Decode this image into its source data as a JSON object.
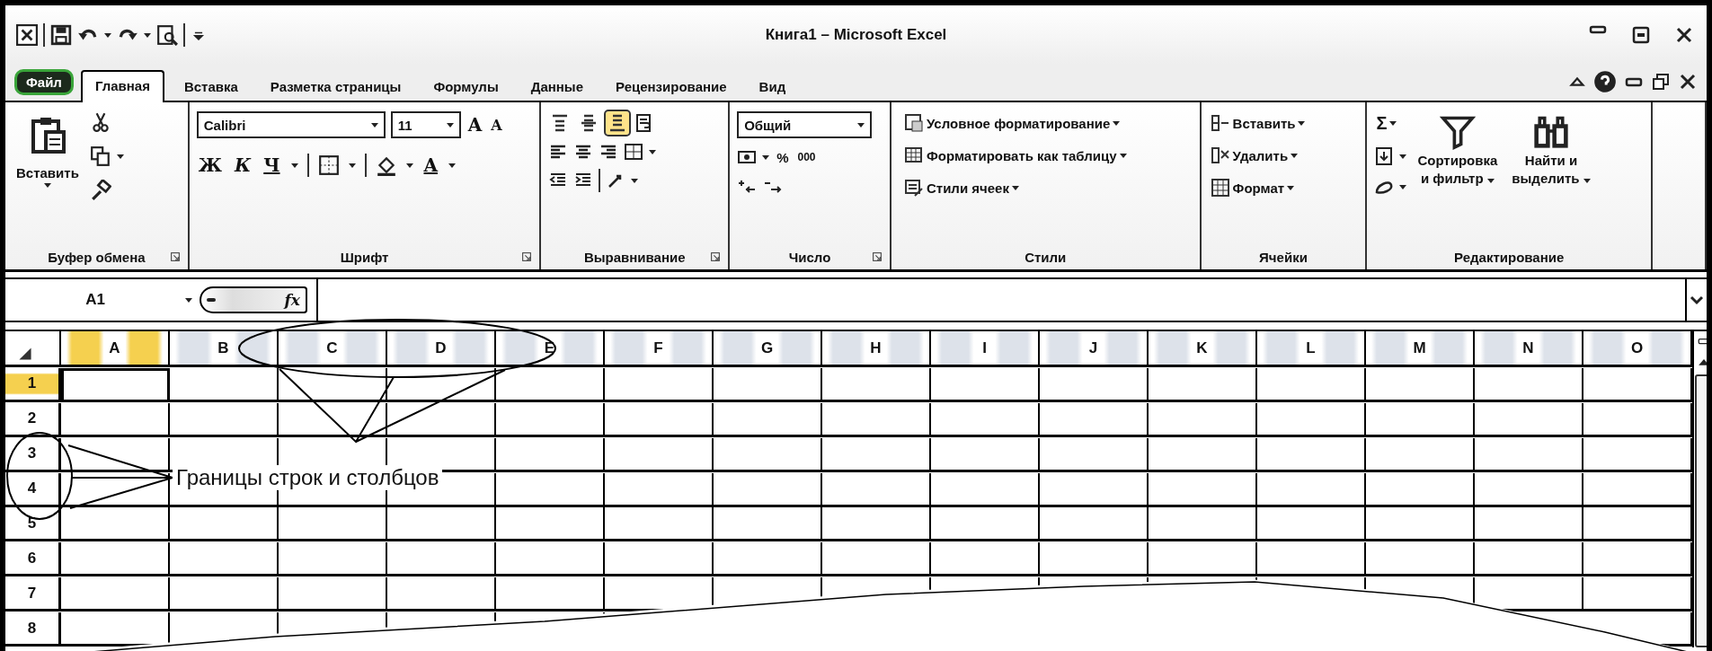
{
  "window": {
    "title": "Книга1 – Microsoft Excel"
  },
  "tabs": [
    {
      "label": "Файл",
      "kind": "file",
      "selected": false
    },
    {
      "label": "Главная",
      "kind": "tab",
      "selected": true
    },
    {
      "label": "Вставка",
      "kind": "tab",
      "selected": false
    },
    {
      "label": "Разметка страницы",
      "kind": "tab",
      "selected": false
    },
    {
      "label": "Формулы",
      "kind": "tab",
      "selected": false
    },
    {
      "label": "Данные",
      "kind": "tab",
      "selected": false
    },
    {
      "label": "Рецензирование",
      "kind": "tab",
      "selected": false
    },
    {
      "label": "Вид",
      "kind": "tab",
      "selected": false
    }
  ],
  "clipboard": {
    "paste_label": "Вставить",
    "group_label": "Буфер обмена"
  },
  "font": {
    "font_name": "Calibri",
    "font_size": "11",
    "grow": "A",
    "shrink": "A",
    "bold": "Ж",
    "italic": "К",
    "underline": "Ч",
    "font_color": "A",
    "group_label": "Шрифт"
  },
  "alignment": {
    "vertical_align": [
      {
        "selected": false
      },
      {
        "selected": false
      },
      {
        "selected": true
      }
    ],
    "group_label": "Выравнивание"
  },
  "number": {
    "format": "Общий",
    "percent": "%",
    "thousands": "000",
    "group_label": "Число"
  },
  "styles": {
    "items": [
      "Условное форматирование",
      "Форматировать как таблицу",
      "Стили ячеек"
    ],
    "group_label": "Стили"
  },
  "cells": {
    "items": [
      "Вставить",
      "Удалить",
      "Формат"
    ],
    "group_label": "Ячейки"
  },
  "editing": {
    "sum": "Σ",
    "sort": [
      "Сортировка",
      "и фильтр"
    ],
    "find": [
      "Найти и",
      "выделить"
    ],
    "group_label": "Редактирование"
  },
  "formula_bar": {
    "name_box": "A1",
    "fx": "fx"
  },
  "sheet": {
    "columns": [
      {
        "label": "A",
        "selected": true
      },
      {
        "label": "B",
        "selected": false
      },
      {
        "label": "C",
        "selected": false
      },
      {
        "label": "D",
        "selected": false
      },
      {
        "label": "E",
        "selected": false
      },
      {
        "label": "F",
        "selected": false
      },
      {
        "label": "G",
        "selected": false
      },
      {
        "label": "H",
        "selected": false
      },
      {
        "label": "I",
        "selected": false
      },
      {
        "label": "J",
        "selected": false
      },
      {
        "label": "K",
        "selected": false
      },
      {
        "label": "L",
        "selected": false
      },
      {
        "label": "M",
        "selected": false
      },
      {
        "label": "N",
        "selected": false
      },
      {
        "label": "O",
        "selected": false
      }
    ],
    "rows": [
      {
        "label": "1",
        "selected": true
      },
      {
        "label": "2",
        "selected": false
      },
      {
        "label": "3",
        "selected": false
      },
      {
        "label": "4",
        "selected": false
      },
      {
        "label": "5",
        "selected": false
      },
      {
        "label": "6",
        "selected": false
      },
      {
        "label": "7",
        "selected": false
      },
      {
        "label": "8",
        "selected": false
      }
    ]
  },
  "annotation": {
    "text": "Границы строк и столбцов"
  }
}
